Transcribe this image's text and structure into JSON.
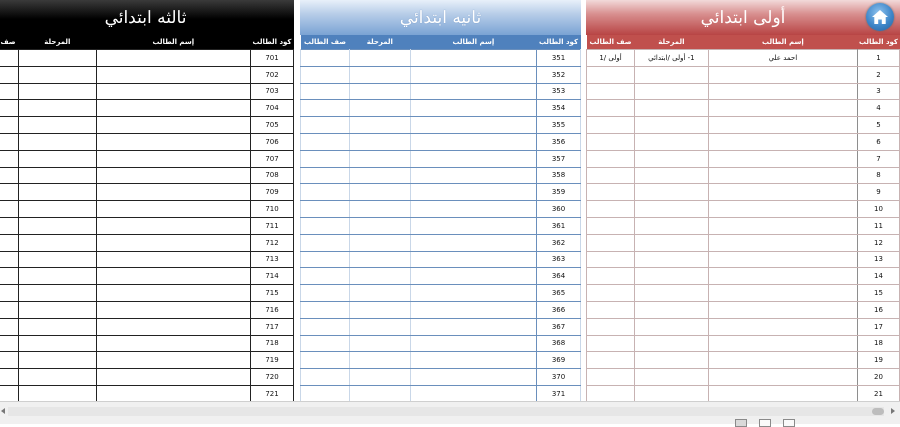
{
  "grade1": {
    "title": "أولى ابتدائي",
    "headers": {
      "code": "كود الطالب",
      "name": "إسم الطالب",
      "stage": "المرحلة",
      "class": "صف الطالب"
    },
    "rows": [
      {
        "code": "1",
        "name": "احمد علي",
        "stage": "1- أولى /ابتدائي",
        "class": "أولى /1"
      },
      {
        "code": "2",
        "name": "",
        "stage": "",
        "class": ""
      },
      {
        "code": "3",
        "name": "",
        "stage": "",
        "class": ""
      },
      {
        "code": "4",
        "name": "",
        "stage": "",
        "class": ""
      },
      {
        "code": "5",
        "name": "",
        "stage": "",
        "class": ""
      },
      {
        "code": "6",
        "name": "",
        "stage": "",
        "class": ""
      },
      {
        "code": "7",
        "name": "",
        "stage": "",
        "class": ""
      },
      {
        "code": "8",
        "name": "",
        "stage": "",
        "class": ""
      },
      {
        "code": "9",
        "name": "",
        "stage": "",
        "class": ""
      },
      {
        "code": "10",
        "name": "",
        "stage": "",
        "class": ""
      },
      {
        "code": "11",
        "name": "",
        "stage": "",
        "class": ""
      },
      {
        "code": "12",
        "name": "",
        "stage": "",
        "class": ""
      },
      {
        "code": "13",
        "name": "",
        "stage": "",
        "class": ""
      },
      {
        "code": "14",
        "name": "",
        "stage": "",
        "class": ""
      },
      {
        "code": "15",
        "name": "",
        "stage": "",
        "class": ""
      },
      {
        "code": "16",
        "name": "",
        "stage": "",
        "class": ""
      },
      {
        "code": "17",
        "name": "",
        "stage": "",
        "class": ""
      },
      {
        "code": "18",
        "name": "",
        "stage": "",
        "class": ""
      },
      {
        "code": "19",
        "name": "",
        "stage": "",
        "class": ""
      },
      {
        "code": "20",
        "name": "",
        "stage": "",
        "class": ""
      },
      {
        "code": "21",
        "name": "",
        "stage": "",
        "class": ""
      }
    ]
  },
  "grade2": {
    "title": "ثانيه ابتدائي",
    "headers": {
      "code": "كود الطالب",
      "name": "إسم الطالب",
      "stage": "المرحلة",
      "class": "صف الطالب"
    },
    "rows": [
      {
        "code": "351"
      },
      {
        "code": "352"
      },
      {
        "code": "353"
      },
      {
        "code": "354"
      },
      {
        "code": "355"
      },
      {
        "code": "356"
      },
      {
        "code": "357"
      },
      {
        "code": "358"
      },
      {
        "code": "359"
      },
      {
        "code": "360"
      },
      {
        "code": "361"
      },
      {
        "code": "362"
      },
      {
        "code": "363"
      },
      {
        "code": "364"
      },
      {
        "code": "365"
      },
      {
        "code": "366"
      },
      {
        "code": "367"
      },
      {
        "code": "368"
      },
      {
        "code": "369"
      },
      {
        "code": "370"
      },
      {
        "code": "371"
      }
    ]
  },
  "grade3": {
    "title": "ثالثه ابتدائي",
    "headers": {
      "code": "كود الطالب",
      "name": "إسم الطالب",
      "stage": "المرحلة",
      "class": "صف"
    },
    "rows": [
      {
        "code": "701"
      },
      {
        "code": "702"
      },
      {
        "code": "703"
      },
      {
        "code": "704"
      },
      {
        "code": "705"
      },
      {
        "code": "706"
      },
      {
        "code": "707"
      },
      {
        "code": "708"
      },
      {
        "code": "709"
      },
      {
        "code": "710"
      },
      {
        "code": "711"
      },
      {
        "code": "712"
      },
      {
        "code": "713"
      },
      {
        "code": "714"
      },
      {
        "code": "715"
      },
      {
        "code": "716"
      },
      {
        "code": "717"
      },
      {
        "code": "718"
      },
      {
        "code": "719"
      },
      {
        "code": "720"
      },
      {
        "code": "721"
      }
    ]
  },
  "home_icon": "home-icon",
  "colors": {
    "grade1": "#c0504d",
    "grade2": "#4f81bd",
    "grade3": "#000000"
  }
}
